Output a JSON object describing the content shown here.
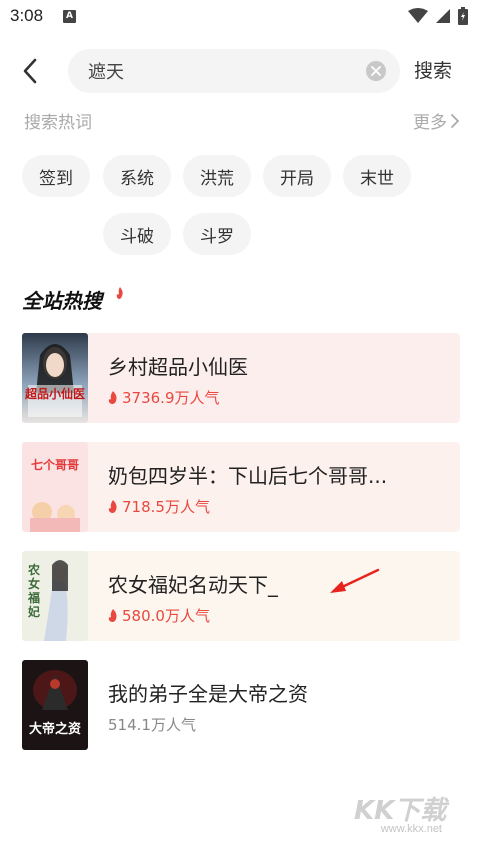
{
  "status_bar": {
    "time": "3:08",
    "notification_badge": "A"
  },
  "search": {
    "value": "遮天",
    "submit_label": "搜索"
  },
  "hot_words": {
    "title": "搜索热词",
    "more_label": "更多",
    "tags": [
      "签到",
      "系统",
      "洪荒",
      "开局",
      "末世",
      "斗破",
      "斗罗"
    ]
  },
  "ranking": {
    "title": "全站热搜",
    "books": [
      {
        "title": "乡村超品小仙医",
        "popularity": "3736.9万人气",
        "cover_text": "超品小仙医"
      },
      {
        "title": "奶包四岁半：下山后七个哥哥...",
        "popularity": "718.5万人气",
        "cover_text": "七个哥哥"
      },
      {
        "title": "农女福妃名动天下_",
        "popularity": "580.0万人气",
        "cover_text": "农女福妃"
      },
      {
        "title": "我的弟子全是大帝之资",
        "popularity": "514.1万人气",
        "cover_text": "大帝之资"
      }
    ]
  },
  "watermark": {
    "brand": "KK下载",
    "url": "www.kkx.net"
  },
  "colors": {
    "accent_red": "#e8483f",
    "highlight_bg_1": "#fdeeee",
    "highlight_bg_2": "#fdf1ee",
    "highlight_bg_3": "#fdf6ef",
    "tag_bg": "#f4f4f4"
  }
}
